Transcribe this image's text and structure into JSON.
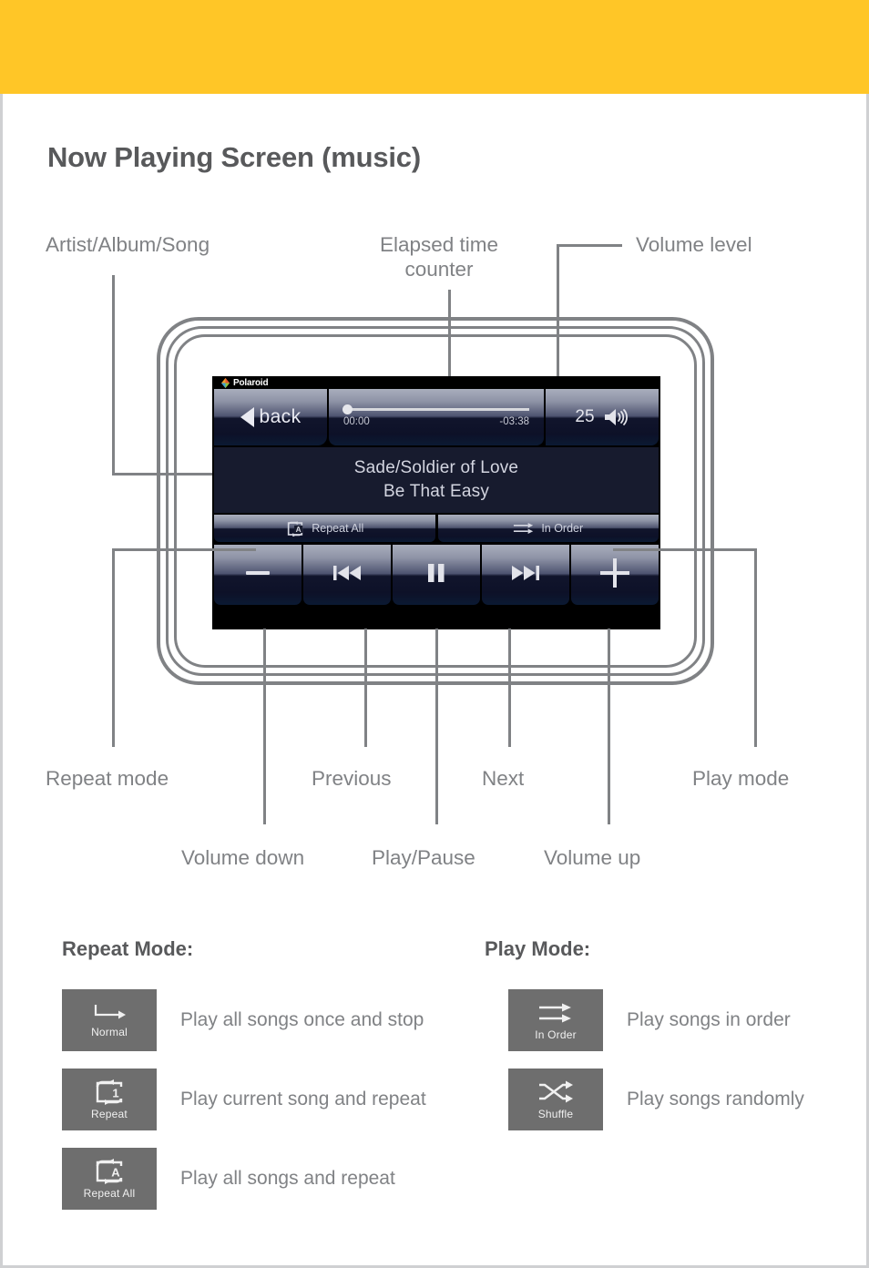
{
  "theme": {
    "banner_color": "#ffc627",
    "heading_color": "#58595b",
    "label_color": "#808285",
    "tile_color": "#6e6e6e",
    "screen_bg": "#000000",
    "nowplaying_bg": "#171b2e"
  },
  "page": {
    "title": "Now Playing Screen (music)"
  },
  "callouts": {
    "artist_album_song": "Artist/Album/Song",
    "elapsed_time_counter": "Elapsed time\ncounter",
    "elapsed_time_counter_line1": "Elapsed time",
    "elapsed_time_counter_line2": "counter",
    "volume_level": "Volume level",
    "repeat_mode": "Repeat mode",
    "previous": "Previous",
    "next": "Next",
    "play_mode": "Play mode",
    "volume_down": "Volume down",
    "play_pause": "Play/Pause",
    "volume_up": "Volume up"
  },
  "device": {
    "brand": "Polaroid",
    "topbar": {
      "back_label": "back",
      "elapsed_time": "00:00",
      "remaining_time": "-03:38",
      "volume_value": "25",
      "progress_percent": 0
    },
    "now_playing": {
      "line1": "Sade/Soldier of Love",
      "line2": "Be That Easy"
    },
    "mode_bar": {
      "repeat_mode_label": "Repeat All",
      "play_mode_label": "In Order"
    },
    "transport": [
      {
        "name": "volume-down",
        "glyph": "minus"
      },
      {
        "name": "previous",
        "glyph": "prev"
      },
      {
        "name": "play-pause",
        "glyph": "pause"
      },
      {
        "name": "next",
        "glyph": "next"
      },
      {
        "name": "volume-up",
        "glyph": "plus"
      }
    ]
  },
  "legend": {
    "repeat_mode": {
      "title": "Repeat Mode:",
      "items": [
        {
          "tile_label": "Normal",
          "icon": "normal-arrow-icon",
          "description": "Play all songs once and stop"
        },
        {
          "tile_label": "Repeat",
          "icon": "repeat-one-icon",
          "description": "Play current song and repeat"
        },
        {
          "tile_label": "Repeat All",
          "icon": "repeat-all-icon",
          "description": "Play all songs and repeat"
        }
      ]
    },
    "play_mode": {
      "title": "Play Mode:",
      "items": [
        {
          "tile_label": "In Order",
          "icon": "in-order-icon",
          "description": "Play songs in order"
        },
        {
          "tile_label": "Shuffle",
          "icon": "shuffle-icon",
          "description": "Play songs randomly"
        }
      ]
    }
  }
}
